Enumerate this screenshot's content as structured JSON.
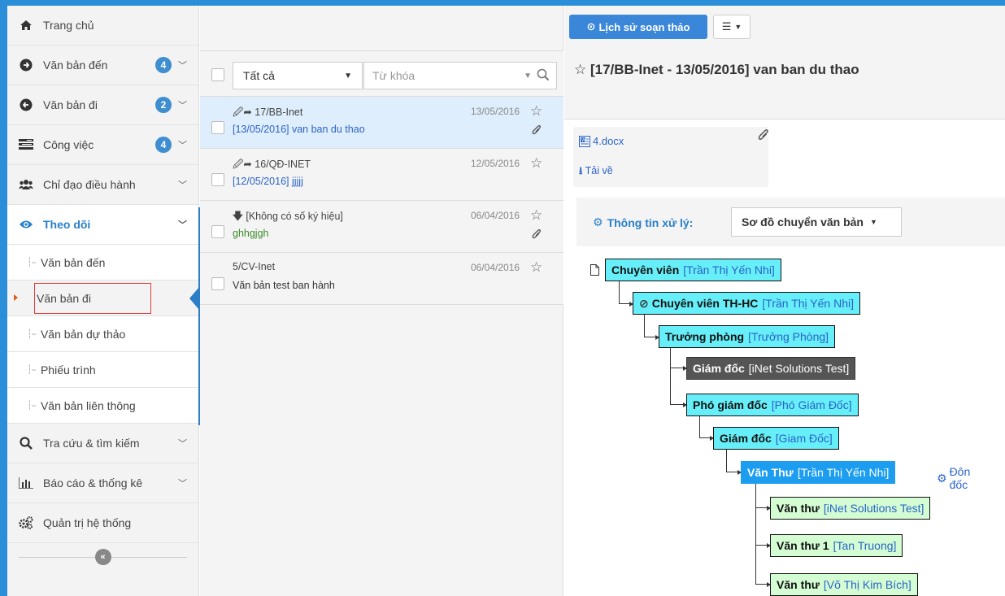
{
  "sidebar": {
    "items": [
      {
        "label": "Trang chủ",
        "icon": "home-icon"
      },
      {
        "label": "Văn bản đến",
        "icon": "arrow-circle-right-icon",
        "badge": "4"
      },
      {
        "label": "Văn bản đi",
        "icon": "arrow-circle-left-icon",
        "badge": "2"
      },
      {
        "label": "Công việc",
        "icon": "tasks-icon",
        "badge": "4"
      },
      {
        "label": "Chỉ đạo điều hành",
        "icon": "users-icon"
      },
      {
        "label": "Theo dõi",
        "icon": "eye-icon"
      }
    ],
    "sub_items": [
      {
        "label": "Văn bản đến"
      },
      {
        "label": "Văn bản đi"
      },
      {
        "label": "Văn bản dự thảo"
      },
      {
        "label": "Phiếu trình"
      },
      {
        "label": "Văn bản liên thông"
      }
    ],
    "bottom_items": [
      {
        "label": "Tra cứu & tìm kiếm",
        "icon": "search-icon"
      },
      {
        "label": "Báo cáo & thống kê",
        "icon": "bar-chart-icon"
      },
      {
        "label": "Quản trị hệ thống",
        "icon": "cogs-icon"
      }
    ],
    "collapse_icon": "double-chevron-left-icon"
  },
  "list": {
    "filter_value": "Tất cả",
    "keyword_placeholder": "Từ khóa",
    "rows": [
      {
        "code": "17/BB-Inet",
        "summary": "[13/05/2016] van ban du thao",
        "date": "13/05/2016",
        "attachment": true
      },
      {
        "code": "16/QĐ-INET",
        "summary": "[12/05/2016] jjjjj",
        "date": "12/05/2016",
        "attachment": false
      },
      {
        "code": "[Không có số ký hiệu]",
        "summary": "ghhgjgh",
        "date": "06/04/2016",
        "attachment": true
      },
      {
        "code": "5/CV-Inet",
        "summary": "Văn bản test ban hành",
        "date": "06/04/2016",
        "attachment": false
      }
    ]
  },
  "detail": {
    "history_button": "Lịch sử soạn thảo",
    "title": "[17/BB-Inet - 13/05/2016] van ban du thao",
    "attachment_name": "4.docx",
    "download_label": "Tải về",
    "info_label": "Thông tin xử lý:",
    "info_select": "Sơ đồ chuyển văn bản",
    "urge_label": "Đôn đốc",
    "tree": [
      {
        "role": "Chuyên viên",
        "who": "[Trần Thị Yến Nhi]",
        "style": "cyan"
      },
      {
        "role": "Chuyên viên TH-HC",
        "who": "[Trần Thị Yến Nhi]",
        "style": "cyan"
      },
      {
        "role": "Trưởng phòng",
        "who": "[Trưởng Phòng]",
        "style": "cyan"
      },
      {
        "role": "Giám đốc",
        "who": "[iNet Solutions Test]",
        "style": "gray"
      },
      {
        "role": "Phó giám đốc",
        "who": "[Phó Giám Đốc]",
        "style": "cyan"
      },
      {
        "role": "Giám đốc",
        "who": "[Giam Đốc]",
        "style": "cyan"
      },
      {
        "role": "Văn Thư",
        "who": "[Trần Thị Yến Nhi]",
        "style": "blue"
      },
      {
        "role": "Văn thư",
        "who": "[iNet Solutions Test]",
        "style": "green"
      },
      {
        "role": "Văn thư 1",
        "who": "[Tan Truong]",
        "style": "green"
      },
      {
        "role": "Văn thư",
        "who": "[Võ Thị Kim Bích]",
        "style": "green"
      }
    ]
  },
  "colors": {
    "brand_blue": "#2a8fd8",
    "badge": "#3e8ed0",
    "node_cyan": "#66eef9",
    "node_green": "#d4fdd4",
    "node_current": "#1c9df0"
  }
}
